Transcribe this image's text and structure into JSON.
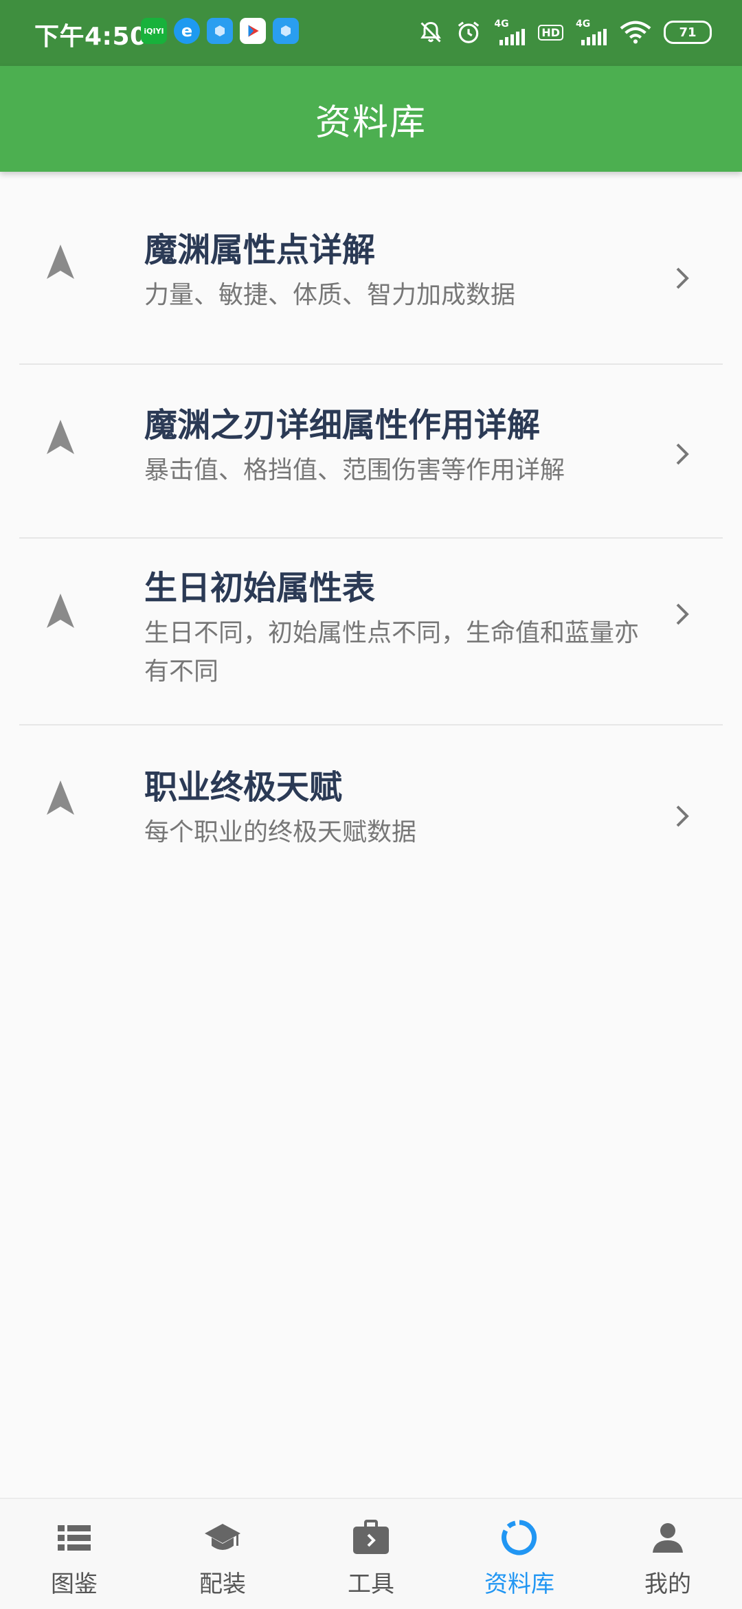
{
  "status_bar": {
    "time": "下午4:50",
    "signal_label_1": "4G",
    "hd_label": "HD",
    "signal_label_2": "4G",
    "battery": "71",
    "apps": [
      {
        "icon": "iqiyi-icon",
        "text": "iQIYI",
        "color": "#18b23b"
      },
      {
        "icon": "browser-icon",
        "text": "e",
        "color": "#1e9af0"
      },
      {
        "icon": "cube-icon",
        "text": "",
        "color": "#2a9ef0"
      },
      {
        "icon": "play-store-icon",
        "text": "▶",
        "color": "#ffffff"
      },
      {
        "icon": "cube-icon",
        "text": "",
        "color": "#2a9ef0"
      }
    ]
  },
  "app_bar": {
    "title": "资料库"
  },
  "list": [
    {
      "title": "魔渊属性点详解",
      "subtitle": "力量、敏捷、体质、智力加成数据"
    },
    {
      "title": "魔渊之刃详细属性作用详解",
      "subtitle": "暴击值、格挡值、范围伤害等作用详解"
    },
    {
      "title": "生日初始属性表",
      "subtitle": "生日不同，初始属性点不同，生命值和蓝量亦有不同"
    },
    {
      "title": "职业终极天赋",
      "subtitle": "每个职业的终极天赋数据"
    }
  ],
  "bottom_nav": [
    {
      "label": "图鉴",
      "icon": "list-icon",
      "active": false
    },
    {
      "label": "配装",
      "icon": "graduation-cap-icon",
      "active": false
    },
    {
      "label": "工具",
      "icon": "toolbox-icon",
      "active": false
    },
    {
      "label": "资料库",
      "icon": "loading-ring-icon",
      "active": true
    },
    {
      "label": "我的",
      "icon": "person-icon",
      "active": false
    }
  ],
  "colors": {
    "app_bar": "#4caf50",
    "status_bar": "#3f8f3f",
    "active_nav": "#2196f3",
    "title_text": "#2b3a55",
    "subtitle_text": "#777777"
  }
}
